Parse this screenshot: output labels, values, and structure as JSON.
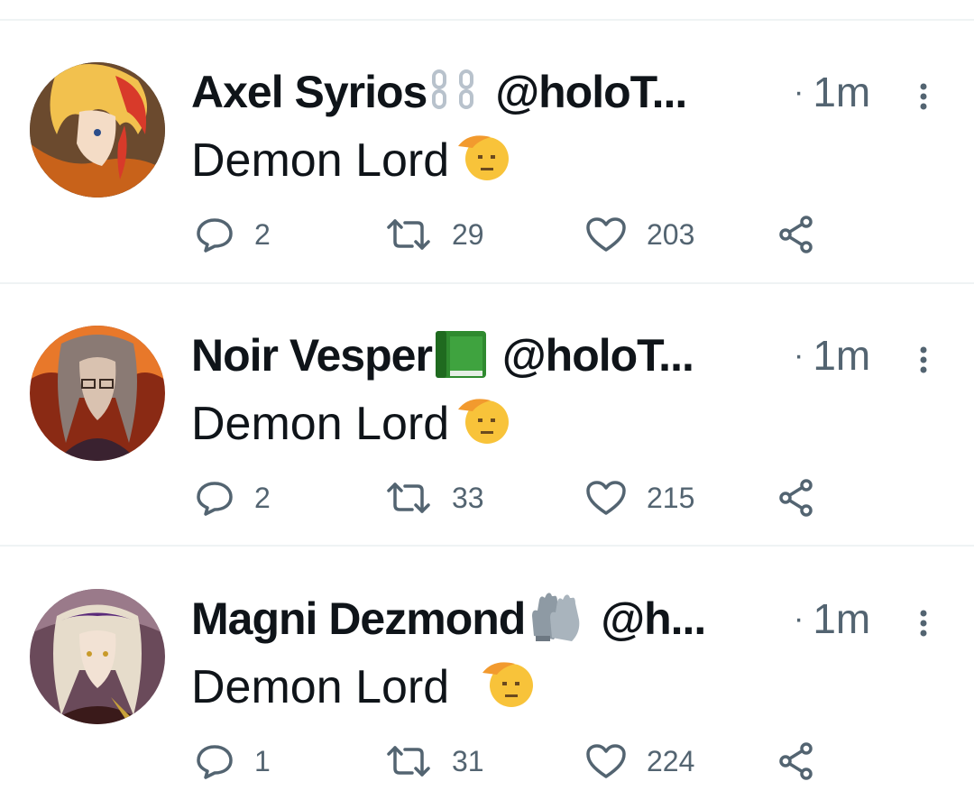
{
  "tweets": [
    {
      "display_name": "Axel Syrios",
      "badge_icon": "chain-link-icon",
      "handle": "@holoT...",
      "time_dot": "·",
      "time": "1m",
      "text": "Demon Lord",
      "text_emoji": "saluting-face-icon",
      "reply_count": "2",
      "retweet_count": "29",
      "like_count": "203"
    },
    {
      "display_name": "Noir Vesper",
      "badge_icon": "green-book-icon",
      "handle": "@holoT...",
      "time_dot": "·",
      "time": "1m",
      "text": "Demon Lord",
      "text_emoji": "saluting-face-icon",
      "reply_count": "2",
      "retweet_count": "33",
      "like_count": "215"
    },
    {
      "display_name": "Magni Dezmond",
      "badge_icon": "grey-gloves-icon",
      "handle": "@h...",
      "time_dot": "·",
      "time": "1m",
      "text": "Demon Lord ",
      "text_emoji": "saluting-face-icon",
      "reply_count": "1",
      "retweet_count": "31",
      "like_count": "224"
    }
  ],
  "colors": {
    "text_primary": "#0f1419",
    "text_secondary": "#536471",
    "divider": "#eff3f4"
  }
}
